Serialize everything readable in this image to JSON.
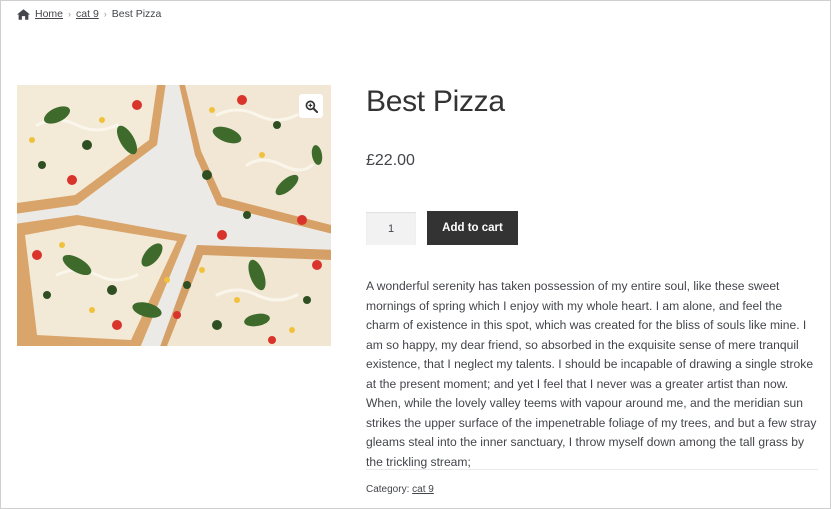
{
  "breadcrumb": {
    "icon": "home-icon",
    "home": "Home",
    "category": "cat 9",
    "current": "Best Pizza"
  },
  "product": {
    "title": "Best Pizza",
    "price": "£22.00",
    "quantity": "1",
    "add_to_cart_label": "Add to cart",
    "image_alt_icon": "zoom-icon",
    "description": "A wonderful serenity has taken possession of my entire soul, like these sweet mornings of spring which I enjoy with my whole heart. I am alone, and feel the charm of existence in this spot, which was created for the bliss of souls like mine. I am so happy, my dear friend, so absorbed in the exquisite sense of mere tranquil existence, that I neglect my talents. I should be incapable of drawing a single stroke at the present moment; and yet I feel that I never was a greater artist than now. When, while the lovely valley teems with vapour around me, and the meridian sun strikes the upper surface of the impenetrable foliage of my trees, and but a few stray gleams steal into the inner sanctuary, I throw myself down among the tall grass by the trickling stream;",
    "category_label": "Category:",
    "category": "cat 9"
  },
  "colors": {
    "text": "#43454b",
    "button_bg": "#333333",
    "button_text": "#ffffff",
    "qty_bg": "#f2f2f2"
  }
}
